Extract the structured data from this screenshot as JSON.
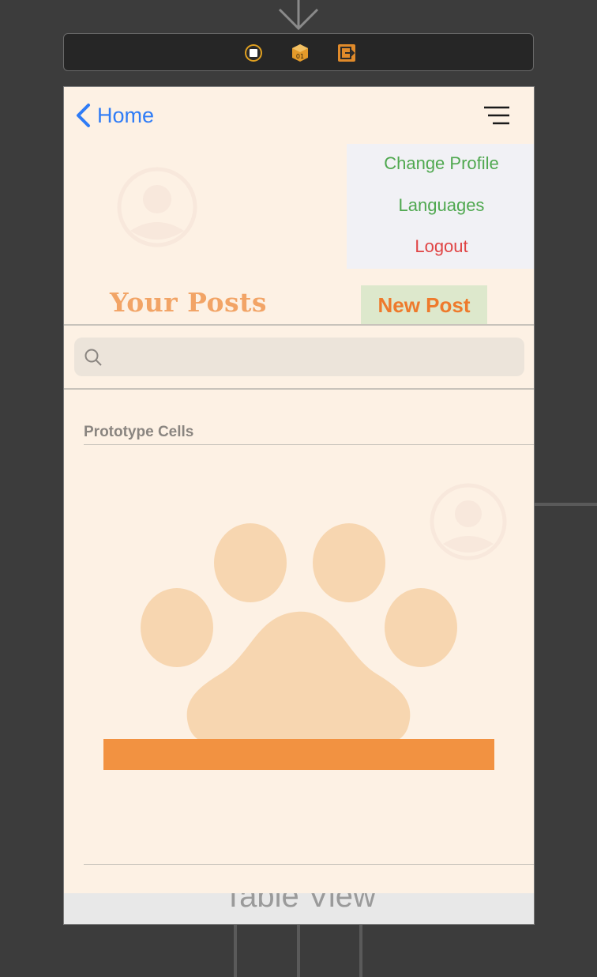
{
  "canvas": {
    "nav": {
      "back_label": "Home",
      "back_icon": "chevron-left-icon",
      "menu_icon": "hamburger-menu-icon"
    },
    "dropdown": {
      "items": [
        "Change Profile",
        "Languages",
        "Logout"
      ]
    },
    "header": {
      "title": "Your Posts",
      "new_post_label": "New Post"
    },
    "search": {
      "placeholder": "",
      "icon": "search-icon"
    },
    "table": {
      "section_label": "Prototype Cells",
      "footer_label": "Table View"
    }
  },
  "dock": {
    "icons": [
      "view-controller-icon",
      "first-responder-icon",
      "exit-icon"
    ]
  },
  "colors": {
    "canvas_bg": "#fdf1e4",
    "accent_blue": "#2f7cf6",
    "green_text": "#4fa84f",
    "red_text": "#e04444",
    "orange": "#f29241",
    "new_post_bg": "#dde8cc"
  }
}
